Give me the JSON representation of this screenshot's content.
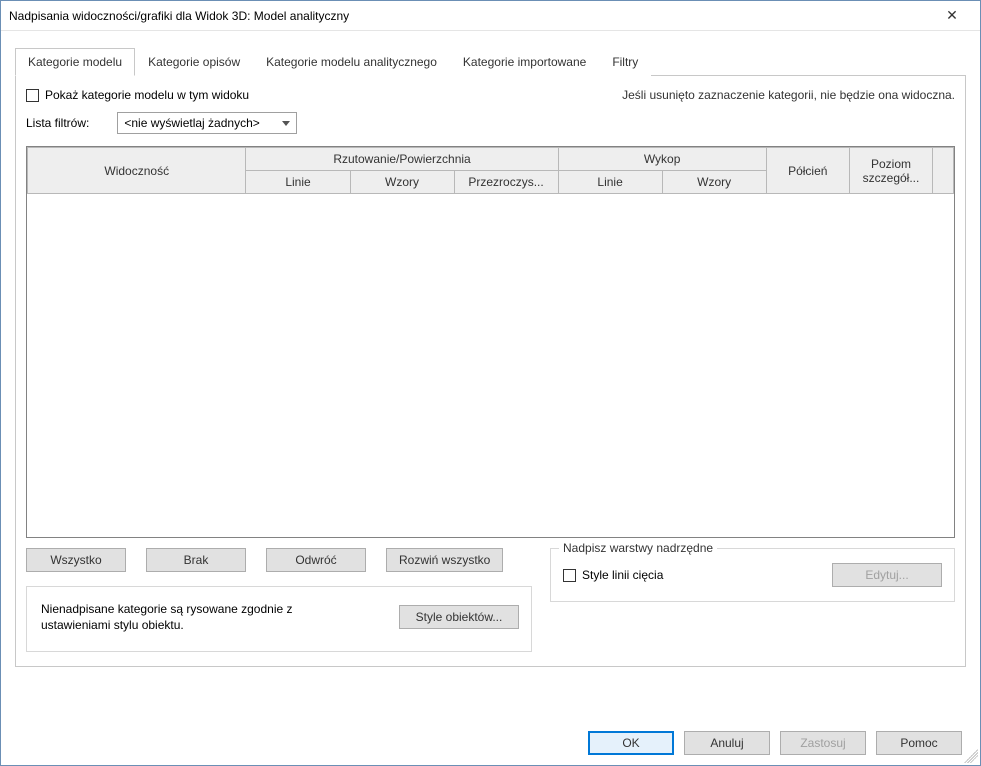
{
  "window": {
    "title": "Nadpisania widoczności/grafiki dla Widok 3D: Model analityczny",
    "close_glyph": "✕"
  },
  "tabs": [
    "Kategorie modelu",
    "Kategorie opisów",
    "Kategorie modelu analitycznego",
    "Kategorie importowane",
    "Filtry"
  ],
  "row1": {
    "show_label": "Pokaż kategorie modelu w tym widoku",
    "hint": "Jeśli usunięto zaznaczenie kategorii, nie będzie ona widoczna."
  },
  "row2": {
    "list_label": "Lista filtrów:",
    "select_value": "<nie wyświetlaj żadnych>"
  },
  "grid_headers": {
    "visibility": "Widoczność",
    "proj_surface": "Rzutowanie/Powierzchnia",
    "proj_lines": "Linie",
    "proj_patterns": "Wzory",
    "proj_transparency": "Przezroczys...",
    "cut": "Wykop",
    "cut_lines": "Linie",
    "cut_patterns": "Wzory",
    "halftone": "Półcień",
    "detail": "Poziom szczegół..."
  },
  "buttons": {
    "all": "Wszystko",
    "none": "Brak",
    "invert": "Odwróć",
    "expand": "Rozwiń wszystko",
    "object_styles": "Style obiektów...",
    "edit": "Edytuj..."
  },
  "info_text": "Nienadpisane kategorie są rysowane zgodnie z ustawieniami stylu obiektu.",
  "group": {
    "legend": "Nadpisz warstwy nadrzędne",
    "cut_line_styles": "Style linii cięcia"
  },
  "footer": {
    "ok": "OK",
    "cancel": "Anuluj",
    "apply": "Zastosuj",
    "help": "Pomoc"
  }
}
